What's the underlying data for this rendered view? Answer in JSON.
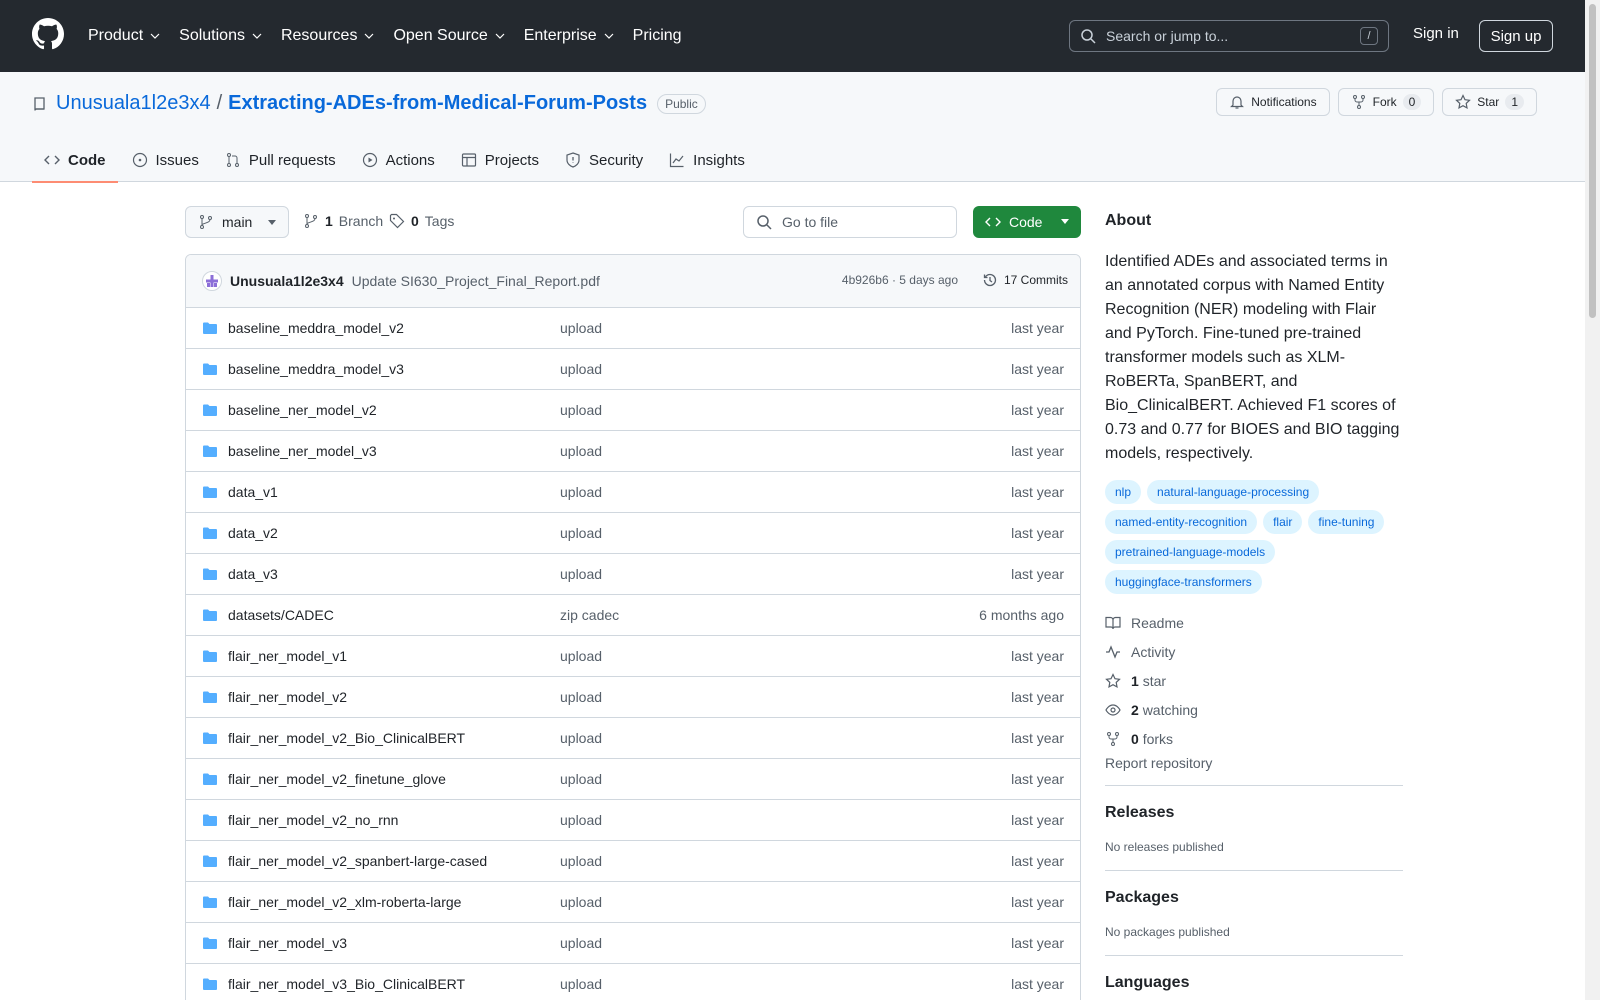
{
  "topnav": {
    "items": [
      {
        "label": "Product",
        "chevron": true
      },
      {
        "label": "Solutions",
        "chevron": true
      },
      {
        "label": "Resources",
        "chevron": true
      },
      {
        "label": "Open Source",
        "chevron": true
      },
      {
        "label": "Enterprise",
        "chevron": true
      },
      {
        "label": "Pricing",
        "chevron": false
      }
    ],
    "search_placeholder": "Search or jump to...",
    "search_shortcut": "/",
    "sign_in": "Sign in",
    "sign_up": "Sign up"
  },
  "repo": {
    "owner": "Unusuala1l2e3x4",
    "separator": "/",
    "name": "Extracting-ADEs-from-Medical-Forum-Posts",
    "visibility": "Public",
    "notifications_label": "Notifications",
    "fork_label": "Fork",
    "fork_count": "0",
    "star_label": "Star",
    "star_count": "1"
  },
  "tabs": [
    "Code",
    "Issues",
    "Pull requests",
    "Actions",
    "Projects",
    "Security",
    "Insights"
  ],
  "branchbar": {
    "branch": "main",
    "branch_count": "1",
    "branch_label": "Branch",
    "tag_count": "0",
    "tag_label": "Tags",
    "goto_placeholder": "Go to file",
    "code_label": "Code"
  },
  "commit": {
    "author": "Unusuala1l2e3x4",
    "message": "Update SI630_Project_Final_Report.pdf",
    "meta": "4b926b6 · 5 days ago",
    "commits_label": "17 Commits"
  },
  "files": [
    {
      "name": "baseline_meddra_model_v2",
      "message": "upload",
      "date": "last year"
    },
    {
      "name": "baseline_meddra_model_v3",
      "message": "upload",
      "date": "last year"
    },
    {
      "name": "baseline_ner_model_v2",
      "message": "upload",
      "date": "last year"
    },
    {
      "name": "baseline_ner_model_v3",
      "message": "upload",
      "date": "last year"
    },
    {
      "name": "data_v1",
      "message": "upload",
      "date": "last year"
    },
    {
      "name": "data_v2",
      "message": "upload",
      "date": "last year"
    },
    {
      "name": "data_v3",
      "message": "upload",
      "date": "last year"
    },
    {
      "name": "datasets/CADEC",
      "message": "zip cadec",
      "date": "6 months ago"
    },
    {
      "name": "flair_ner_model_v1",
      "message": "upload",
      "date": "last year"
    },
    {
      "name": "flair_ner_model_v2",
      "message": "upload",
      "date": "last year"
    },
    {
      "name": "flair_ner_model_v2_Bio_ClinicalBERT",
      "message": "upload",
      "date": "last year"
    },
    {
      "name": "flair_ner_model_v2_finetune_glove",
      "message": "upload",
      "date": "last year"
    },
    {
      "name": "flair_ner_model_v2_no_rnn",
      "message": "upload",
      "date": "last year"
    },
    {
      "name": "flair_ner_model_v2_spanbert-large-cased",
      "message": "upload",
      "date": "last year"
    },
    {
      "name": "flair_ner_model_v2_xlm-roberta-large",
      "message": "upload",
      "date": "last year"
    },
    {
      "name": "flair_ner_model_v3",
      "message": "upload",
      "date": "last year"
    },
    {
      "name": "flair_ner_model_v3_Bio_ClinicalBERT",
      "message": "upload",
      "date": "last year"
    }
  ],
  "about": {
    "heading": "About",
    "description": "Identified ADEs and associated terms in an annotated corpus with Named Entity Recognition (NER) modeling with Flair and PyTorch. Fine-tuned pre-trained transformer models such as XLM-RoBERTa, SpanBERT, and Bio_ClinicalBERT. Achieved F1 scores of 0.73 and 0.77 for BIOES and BIO tagging models, respectively.",
    "topics": [
      "nlp",
      "natural-language-processing",
      "named-entity-recognition",
      "flair",
      "fine-tuning",
      "pretrained-language-models",
      "huggingface-transformers"
    ],
    "readme": "Readme",
    "activity": "Activity",
    "stars_count": "1",
    "stars_label": "star",
    "watching_count": "2",
    "watching_label": "watching",
    "forks_count": "0",
    "forks_label": "forks",
    "report": "Report repository"
  },
  "releases": {
    "heading": "Releases",
    "text": "No releases published"
  },
  "packages": {
    "heading": "Packages",
    "text": "No packages published"
  },
  "languages": {
    "heading": "Languages"
  },
  "colors": {
    "header_bg": "#24292f",
    "link": "#0969da",
    "code_button": "#1f883d",
    "active_tab": "#fd8c73",
    "folder": "#54aeff"
  }
}
